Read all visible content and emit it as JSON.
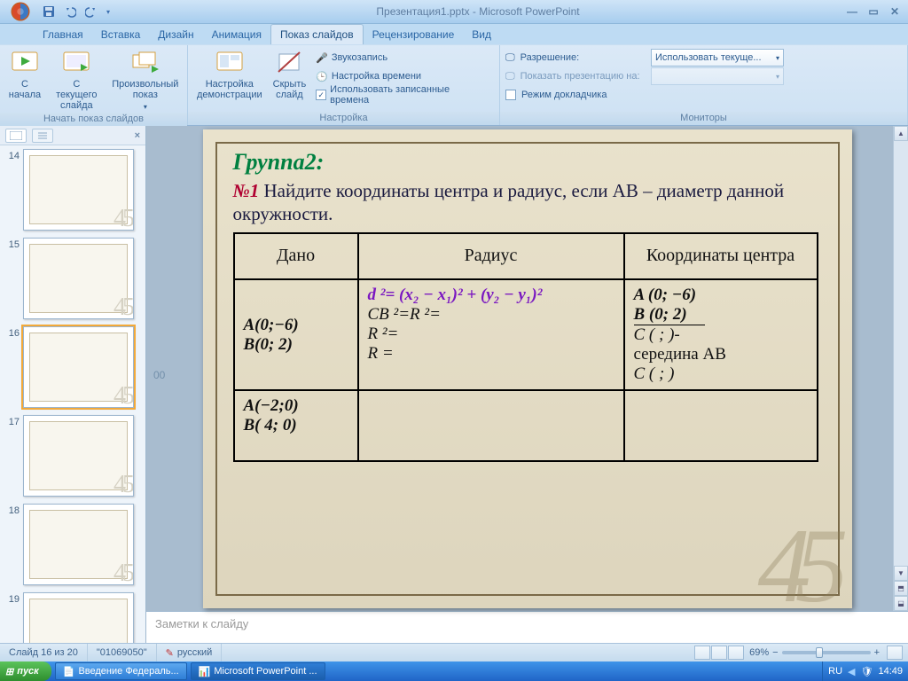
{
  "title": "Презентация1.pptx - Microsoft PowerPoint",
  "tabs": [
    "Главная",
    "Вставка",
    "Дизайн",
    "Анимация",
    "Показ слайдов",
    "Рецензирование",
    "Вид"
  ],
  "activeTab": 4,
  "ribbon": {
    "group1": {
      "label": "Начать показ слайдов",
      "btn1": "С\nначала",
      "btn2": "С текущего\nслайда",
      "btn3": "Произвольный\nпоказ"
    },
    "group2": {
      "label": "Настройка",
      "btn1": "Настройка\nдемонстрации",
      "btn2": "Скрыть\nслайд",
      "row1": "Звукозапись",
      "row2": "Настройка времени",
      "row3": "Использовать записанные времена"
    },
    "group3": {
      "label": "Мониторы",
      "row1": "Разрешение:",
      "row2": "Показать презентацию на:",
      "row3": "Режим докладчика",
      "combo": "Использовать текуще..."
    }
  },
  "thumbs": [
    {
      "num": "14"
    },
    {
      "num": "15"
    },
    {
      "num": "16",
      "sel": true
    },
    {
      "num": "17"
    },
    {
      "num": "18"
    },
    {
      "num": "19"
    }
  ],
  "slide": {
    "heading": "Группа2:",
    "taskNo": "№1",
    "taskText": "  Найдите координаты центра и радиус, если АВ – диаметр данной окружности.",
    "th1": "Дано",
    "th2": "Радиус",
    "th3": "Координаты центра",
    "r1c1a": "A(0;−6)",
    "r1c1b": "B(0; 2)",
    "r1c2a": "d ²= (x₂ − x₁)² + (y₂ − y₁)²",
    "r1c2b": "CB ²=R ²=",
    "r1c2c": "R ²=",
    "r1c2d": "R =",
    "r1c3a": "A (0; −6)",
    "r1c3b": "B (0;   2)",
    "r1c3c": "C (       ;       )-",
    "r1c3d": "середина АВ",
    "r1c3e": "C (      ;       )",
    "r2c1a": "A(−2;0)",
    "r2c1b": "B( 4; 0)"
  },
  "notes": "Заметки к слайду",
  "status": {
    "slide": "Слайд 16 из 20",
    "theme": "\"01069050\"",
    "lang": "русский",
    "zoom": "69%"
  },
  "taskbar": {
    "start": "пуск",
    "btn1": "Введение Федераль...",
    "btn2": "Microsoft PowerPoint ...",
    "lang": "RU",
    "time": "14:49"
  },
  "edgeNum": "00"
}
